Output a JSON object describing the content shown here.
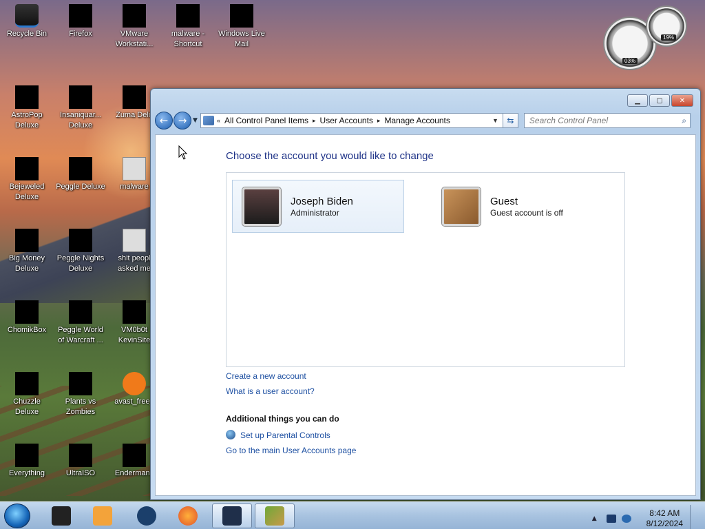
{
  "desktop": {
    "icons": [
      {
        "label": "Recycle Bin",
        "icon": "recycle-bin-icon"
      },
      {
        "label": "Firefox",
        "icon": "firefox-icon"
      },
      {
        "label": "VMware\nWorkstati...",
        "icon": "vmware-icon"
      },
      {
        "label": "malware -\nShortcut",
        "icon": "shortcut-icon"
      },
      {
        "label": "Windows Live\nMail",
        "icon": "mail-icon"
      },
      {
        "label": "AstroPop\nDeluxe",
        "icon": "game-icon"
      },
      {
        "label": "Insaniquar...\nDeluxe",
        "icon": "game-icon"
      },
      {
        "label": "Zuma Delu",
        "icon": "game-icon"
      },
      {
        "label": "Bejeweled\nDeluxe",
        "icon": "game-icon"
      },
      {
        "label": "Peggle Deluxe",
        "icon": "game-icon"
      },
      {
        "label": "malware",
        "icon": "folder-icon"
      },
      {
        "label": "Big Money\nDeluxe",
        "icon": "game-icon"
      },
      {
        "label": "Peggle Nights\nDeluxe",
        "icon": "game-icon"
      },
      {
        "label": "shit peopl\nasked me",
        "icon": "folder-icon"
      },
      {
        "label": "ChomikBox",
        "icon": "chomikbox-icon"
      },
      {
        "label": "Peggle World\nof Warcraft ...",
        "icon": "game-icon"
      },
      {
        "label": "VM0b0t\nKevinSite",
        "icon": "file-icon"
      },
      {
        "label": "Chuzzle\nDeluxe",
        "icon": "game-icon"
      },
      {
        "label": "Plants vs\nZombies",
        "icon": "game-icon"
      },
      {
        "label": "avast_free_",
        "icon": "avast-icon"
      },
      {
        "label": "Everything",
        "icon": "search-tool-icon"
      },
      {
        "label": "UltraISO",
        "icon": "disc-icon"
      },
      {
        "label": "Endermanc",
        "icon": "terminal-icon"
      }
    ],
    "gadget": {
      "cpu": "03%",
      "ram": "19%"
    }
  },
  "window": {
    "nav": {
      "back": "back-arrow-icon",
      "forward": "forward-arrow-icon"
    },
    "breadcrumb": {
      "root_sep": "«",
      "items": [
        "All Control Panel Items",
        "User Accounts",
        "Manage Accounts"
      ],
      "sep": "▸"
    },
    "search": {
      "placeholder": "Search Control Panel"
    },
    "heading": "Choose the account you would like to change",
    "accounts": [
      {
        "name": "Joseph Biden",
        "role": "Administrator"
      },
      {
        "name": "Guest",
        "role": "Guest account is off"
      }
    ],
    "links": {
      "create": "Create a new account",
      "what_is": "What is a user account?"
    },
    "additional": {
      "title": "Additional things you can do",
      "parental": "Set up Parental Controls",
      "main_page": "Go to the main User Accounts page"
    }
  },
  "taskbar": {
    "time": "8:42 AM",
    "date": "8/12/2024"
  }
}
